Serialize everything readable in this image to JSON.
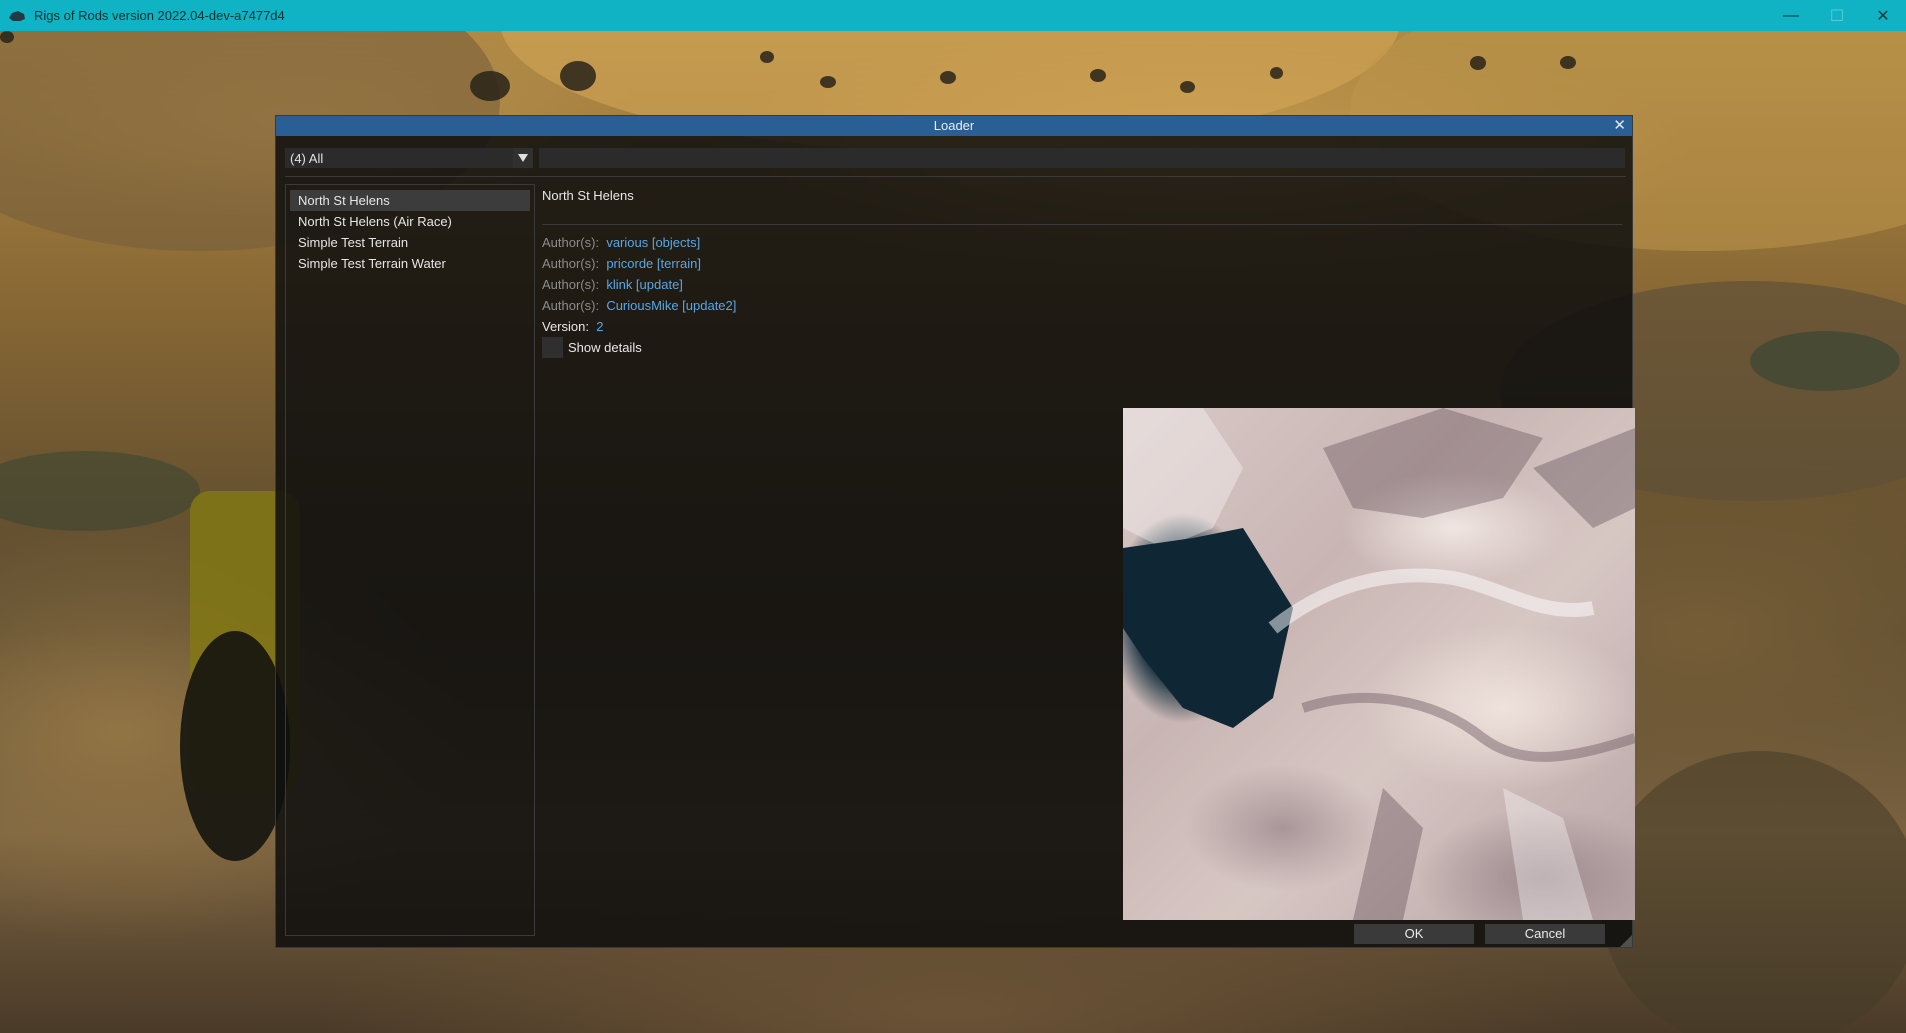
{
  "window": {
    "title": "Rigs of Rods version 2022.04-dev-a7477d4",
    "controls": {
      "minimize": "—",
      "maximize": "☐",
      "close": "✕"
    }
  },
  "loader": {
    "title": "Loader",
    "close_glyph": "✕",
    "category_combo": {
      "selected": "(4) All",
      "arrow": "▼"
    },
    "search": {
      "value": "",
      "placeholder": ""
    },
    "items": [
      {
        "label": "North St Helens",
        "selected": true
      },
      {
        "label": "North St Helens (Air Race)",
        "selected": false
      },
      {
        "label": "Simple Test Terrain",
        "selected": false
      },
      {
        "label": "Simple Test Terrain Water",
        "selected": false
      }
    ],
    "details": {
      "name": "North St Helens",
      "authors": [
        {
          "label": "Author(s):",
          "value": "various [objects]"
        },
        {
          "label": "Author(s):",
          "value": "pricorde [terrain]"
        },
        {
          "label": "Author(s):",
          "value": "klink [update]"
        },
        {
          "label": "Author(s):",
          "value": "CuriousMike [update2]"
        }
      ],
      "version_label": "Version:",
      "version_value": "2",
      "show_details_label": "Show details",
      "show_details_checked": false
    },
    "ok_label": "OK",
    "cancel_label": "Cancel"
  },
  "colors": {
    "titlebar": "#0fb3c4",
    "dialog_title": "#2a5f96",
    "link": "#59a6e6"
  }
}
